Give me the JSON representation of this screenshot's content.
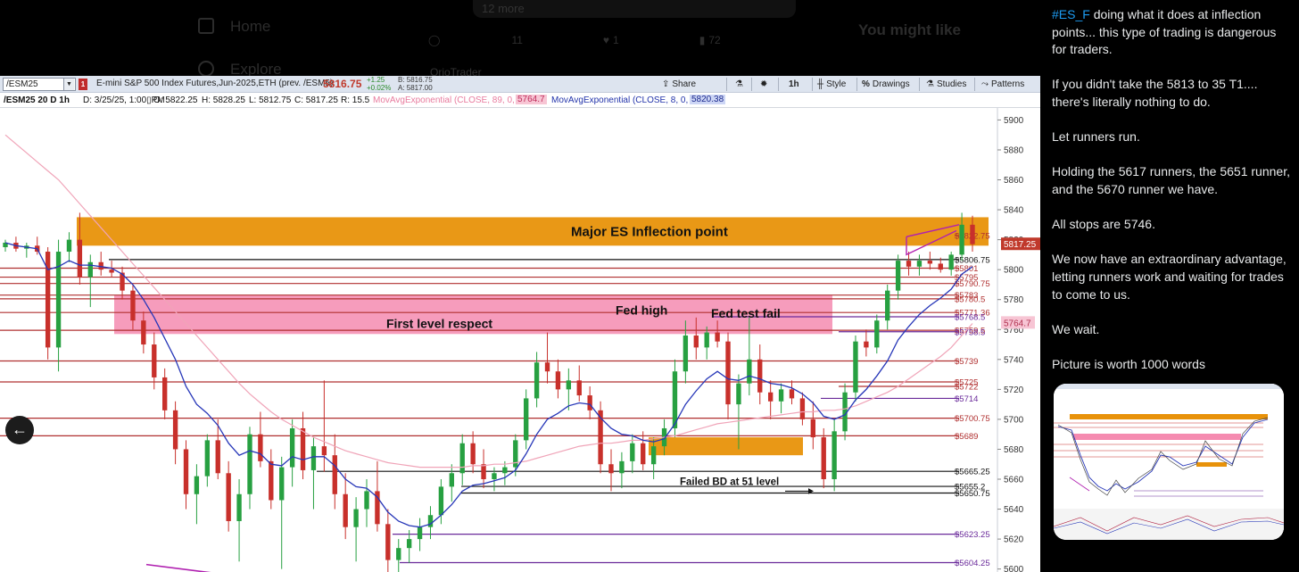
{
  "background": {
    "nav": [
      "Home",
      "Explore"
    ],
    "search_text": "12 more",
    "stats": [
      "11",
      "1",
      "72"
    ],
    "might_like": "You might like",
    "user": "OrioTrader"
  },
  "toolbar": {
    "symbol": "/ESM25",
    "flag": "1",
    "description": "E-mini S&P 500 Index Futures,Jun-2025,ETH (prev. /ESM5)",
    "last": "5816.75",
    "change": "+1.25",
    "change_pct": "+0.02%",
    "bid": "B: 5816.75",
    "ask": "A: 5817.00",
    "share": "Share",
    "timeframe": "1h",
    "style": "Style",
    "drawings": "Drawings",
    "studies": "Studies",
    "patterns": "Patterns"
  },
  "ohlc_bar": {
    "symbol_tf": "/ESM25 20 D 1h",
    "date": "D: 3/25/25, 1:00▯PM",
    "open": "O: 5822.25",
    "high": "H: 5828.25",
    "low": "L: 5812.75",
    "close": "C: 5817.25",
    "range": "R: 15.5",
    "ema89_label": "MovAvgExponential (CLOSE, 89, 0, no)",
    "ema89_value": "5764.7",
    "ema8_label": "MovAvgExponential (CLOSE, 8, 0, no)",
    "ema8_value": "5820.38"
  },
  "chart_data": {
    "type": "candlestick",
    "y_axis_ticks": [
      5900,
      5880,
      5860,
      5840,
      5820,
      5800,
      5780,
      5760,
      5740,
      5720,
      5700,
      5680,
      5660,
      5640,
      5620,
      5600
    ],
    "ylim": [
      5598,
      5908
    ],
    "current_price": "5817.25",
    "ema89_price": "5764.7",
    "annotations": [
      "Major ES Inflection point",
      "First level respect",
      "Fed high",
      "Fed test fail",
      "Failed BD at 51 level"
    ],
    "level_labels": [
      {
        "price": 5822.75,
        "text": "$5822.75",
        "color": "#b03030"
      },
      {
        "price": 5806.75,
        "text": "$5806.75",
        "color": "#111111"
      },
      {
        "price": 5801,
        "text": "$5801",
        "color": "#b03030"
      },
      {
        "price": 5795,
        "text": "$5795",
        "color": "#b03030"
      },
      {
        "price": 5790.75,
        "text": "$5790.75",
        "color": "#b03030"
      },
      {
        "price": 5783,
        "text": "$5783",
        "color": "#b03030"
      },
      {
        "price": 5780.5,
        "text": "$5780.5",
        "color": "#b03030"
      },
      {
        "price": 5771.36,
        "text": "$5771.36",
        "color": "#b03030"
      },
      {
        "price": 5768.5,
        "text": "$5768.5",
        "color": "#6a2a9a"
      },
      {
        "price": 5759.5,
        "text": "$5759.5",
        "color": "#b03030"
      },
      {
        "price": 5758.5,
        "text": "$5758.5",
        "color": "#6a2a9a"
      },
      {
        "price": 5739,
        "text": "$5739",
        "color": "#b03030"
      },
      {
        "price": 5725,
        "text": "$5725",
        "color": "#b03030"
      },
      {
        "price": 5722,
        "text": "$5722",
        "color": "#b03030"
      },
      {
        "price": 5714,
        "text": "$5714",
        "color": "#6a2a9a"
      },
      {
        "price": 5700.75,
        "text": "$5700.75",
        "color": "#b03030"
      },
      {
        "price": 5689,
        "text": "$5689",
        "color": "#b03030"
      },
      {
        "price": 5665.25,
        "text": "$5665.25",
        "color": "#111111"
      },
      {
        "price": 5655.2,
        "text": "$5655.2",
        "color": "#111111"
      },
      {
        "price": 5650.75,
        "text": "$5650.75",
        "color": "#111111"
      },
      {
        "price": 5623.25,
        "text": "$5623.25",
        "color": "#6a2a9a"
      },
      {
        "price": 5604.25,
        "text": "$5604.25",
        "color": "#6a2a9a"
      }
    ],
    "zones": [
      {
        "name": "major-inflection",
        "from": 5816,
        "to": 5835,
        "color": "#e8920a"
      },
      {
        "name": "first-level",
        "from": 5757,
        "to": 5783,
        "color": "#f58bb0"
      },
      {
        "name": "fed-low",
        "from": 5676,
        "to": 5688,
        "color": "#e8920a"
      }
    ],
    "candles": [
      [
        5815,
        5820,
        5812,
        5818
      ],
      [
        5818,
        5822,
        5812,
        5814
      ],
      [
        5814,
        5818,
        5808,
        5816
      ],
      [
        5816,
        5822,
        5810,
        5812
      ],
      [
        5812,
        5815,
        5740,
        5748
      ],
      [
        5748,
        5820,
        5732,
        5812
      ],
      [
        5812,
        5825,
        5805,
        5820
      ],
      [
        5820,
        5838,
        5790,
        5795
      ],
      [
        5795,
        5810,
        5775,
        5805
      ],
      [
        5805,
        5812,
        5796,
        5800
      ],
      [
        5800,
        5806,
        5795,
        5798
      ],
      [
        5798,
        5802,
        5780,
        5786
      ],
      [
        5786,
        5790,
        5760,
        5766
      ],
      [
        5766,
        5772,
        5744,
        5750
      ],
      [
        5750,
        5758,
        5720,
        5728
      ],
      [
        5728,
        5734,
        5700,
        5706
      ],
      [
        5706,
        5712,
        5670,
        5680
      ],
      [
        5680,
        5686,
        5640,
        5650
      ],
      [
        5650,
        5670,
        5630,
        5662
      ],
      [
        5662,
        5690,
        5655,
        5686
      ],
      [
        5686,
        5700,
        5660,
        5664
      ],
      [
        5664,
        5672,
        5625,
        5632
      ],
      [
        5632,
        5660,
        5605,
        5650
      ],
      [
        5650,
        5695,
        5640,
        5690
      ],
      [
        5690,
        5705,
        5668,
        5672
      ],
      [
        5672,
        5680,
        5640,
        5646
      ],
      [
        5646,
        5675,
        5600,
        5668
      ],
      [
        5668,
        5700,
        5655,
        5694
      ],
      [
        5694,
        5705,
        5660,
        5666
      ],
      [
        5666,
        5688,
        5640,
        5682
      ],
      [
        5682,
        5726,
        5665,
        5676
      ],
      [
        5676,
        5690,
        5640,
        5650
      ],
      [
        5650,
        5664,
        5620,
        5628
      ],
      [
        5628,
        5648,
        5605,
        5640
      ],
      [
        5640,
        5660,
        5628,
        5652
      ],
      [
        5652,
        5672,
        5625,
        5630
      ],
      [
        5630,
        5640,
        5596,
        5606
      ],
      [
        5606,
        5620,
        5596,
        5614
      ],
      [
        5614,
        5626,
        5604,
        5620
      ],
      [
        5620,
        5634,
        5612,
        5628
      ],
      [
        5628,
        5642,
        5620,
        5636
      ],
      [
        5636,
        5660,
        5630,
        5655
      ],
      [
        5655,
        5670,
        5645,
        5664
      ],
      [
        5664,
        5690,
        5656,
        5684
      ],
      [
        5684,
        5692,
        5664,
        5670
      ],
      [
        5670,
        5680,
        5654,
        5660
      ],
      [
        5660,
        5668,
        5652,
        5664
      ],
      [
        5664,
        5672,
        5656,
        5668
      ],
      [
        5668,
        5690,
        5662,
        5686
      ],
      [
        5686,
        5720,
        5680,
        5714
      ],
      [
        5714,
        5745,
        5708,
        5738
      ],
      [
        5738,
        5758,
        5724,
        5732
      ],
      [
        5732,
        5740,
        5714,
        5720
      ],
      [
        5720,
        5734,
        5706,
        5726
      ],
      [
        5726,
        5736,
        5712,
        5716
      ],
      [
        5716,
        5722,
        5700,
        5706
      ],
      [
        5706,
        5712,
        5664,
        5670
      ],
      [
        5670,
        5680,
        5652,
        5664
      ],
      [
        5664,
        5678,
        5654,
        5672
      ],
      [
        5672,
        5690,
        5664,
        5684
      ],
      [
        5684,
        5692,
        5666,
        5670
      ],
      [
        5670,
        5688,
        5660,
        5682
      ],
      [
        5682,
        5700,
        5676,
        5694
      ],
      [
        5694,
        5740,
        5688,
        5732
      ],
      [
        5732,
        5766,
        5724,
        5756
      ],
      [
        5756,
        5768,
        5740,
        5748
      ],
      [
        5748,
        5762,
        5740,
        5758
      ],
      [
        5758,
        5766,
        5748,
        5752
      ],
      [
        5752,
        5758,
        5700,
        5710
      ],
      [
        5710,
        5730,
        5680,
        5724
      ],
      [
        5724,
        5768,
        5716,
        5740
      ],
      [
        5740,
        5750,
        5710,
        5718
      ],
      [
        5718,
        5726,
        5700,
        5712
      ],
      [
        5712,
        5724,
        5704,
        5720
      ],
      [
        5720,
        5726,
        5710,
        5714
      ],
      [
        5714,
        5718,
        5696,
        5700
      ],
      [
        5700,
        5712,
        5680,
        5688
      ],
      [
        5688,
        5694,
        5654,
        5660
      ],
      [
        5660,
        5700,
        5652,
        5692
      ],
      [
        5692,
        5724,
        5686,
        5718
      ],
      [
        5718,
        5756,
        5712,
        5752
      ],
      [
        5752,
        5760,
        5742,
        5748
      ],
      [
        5748,
        5770,
        5744,
        5766
      ],
      [
        5766,
        5790,
        5760,
        5786
      ],
      [
        5786,
        5810,
        5780,
        5806
      ],
      [
        5806,
        5812,
        5796,
        5802
      ],
      [
        5802,
        5810,
        5796,
        5806
      ],
      [
        5806,
        5812,
        5800,
        5804
      ],
      [
        5804,
        5808,
        5798,
        5800
      ],
      [
        5800,
        5812,
        5796,
        5810
      ],
      [
        5810,
        5838,
        5806,
        5830
      ],
      [
        5830,
        5836,
        5812,
        5817
      ]
    ],
    "ema8": [
      5818,
      5816,
      5815,
      5814,
      5800,
      5802,
      5806,
      5803,
      5803,
      5802,
      5801,
      5797,
      5790,
      5780,
      5768,
      5754,
      5740,
      5722,
      5710,
      5704,
      5696,
      5684,
      5676,
      5679,
      5677,
      5670,
      5669,
      5675,
      5673,
      5675,
      5675,
      5669,
      5660,
      5655,
      5654,
      5648,
      5638,
      5632,
      5629,
      5628,
      5630,
      5636,
      5643,
      5652,
      5656,
      5657,
      5659,
      5661,
      5666,
      5677,
      5690,
      5700,
      5704,
      5709,
      5711,
      5710,
      5701,
      5694,
      5690,
      5689,
      5686,
      5685,
      5687,
      5697,
      5710,
      5719,
      5727,
      5732,
      5727,
      5726,
      5729,
      5727,
      5724,
      5723,
      5721,
      5717,
      5711,
      5702,
      5700,
      5703,
      5713,
      5720,
      5729,
      5739,
      5753,
      5762,
      5770,
      5776,
      5781,
      5787,
      5797,
      5802
    ],
    "ema89": [
      5890,
      5884,
      5878,
      5872,
      5866,
      5860,
      5852,
      5844,
      5836,
      5828,
      5820,
      5812,
      5804,
      5796,
      5788,
      5780,
      5772,
      5764,
      5756,
      5748,
      5740,
      5732,
      5724,
      5717,
      5711,
      5705,
      5700,
      5696,
      5692,
      5688,
      5685,
      5682,
      5679,
      5677,
      5675,
      5673,
      5671,
      5670,
      5669,
      5668,
      5668,
      5668,
      5668,
      5668,
      5669,
      5669,
      5670,
      5670,
      5671,
      5672,
      5674,
      5676,
      5678,
      5680,
      5682,
      5683,
      5684,
      5684,
      5685,
      5686,
      5686,
      5687,
      5688,
      5689,
      5691,
      5693,
      5695,
      5697,
      5698,
      5699,
      5700,
      5701,
      5702,
      5703,
      5704,
      5705,
      5705,
      5706,
      5706,
      5707,
      5709,
      5712,
      5715,
      5718,
      5722,
      5727,
      5732,
      5737,
      5742,
      5748,
      5756,
      5764
    ]
  },
  "tweet": {
    "hashtag": "#ES_F",
    "paragraphs": [
      " doing what it does at inflection points... this type of trading is dangerous for traders.",
      "If you didn't take the 5813  to 35 T1.... there's literally nothing to do.",
      "Let runners run.",
      "Holding the 5617 runners, the 5651 runner, and the 5670 runner we have.",
      "All stops are 5746.",
      "We now have an extraordinary advantage, letting runners work and waiting for trades to come to us.",
      "We wait.",
      "Picture is worth 1000 words"
    ]
  },
  "colors": {
    "inflection_zone": "#e8920a",
    "pink_zone": "#f58bb0",
    "up_candle": "#27a041",
    "down_candle": "#c8302b",
    "ema8": "#2636b8",
    "ema89": "#f0a4b8",
    "hashtag": "#1d9bf0"
  }
}
